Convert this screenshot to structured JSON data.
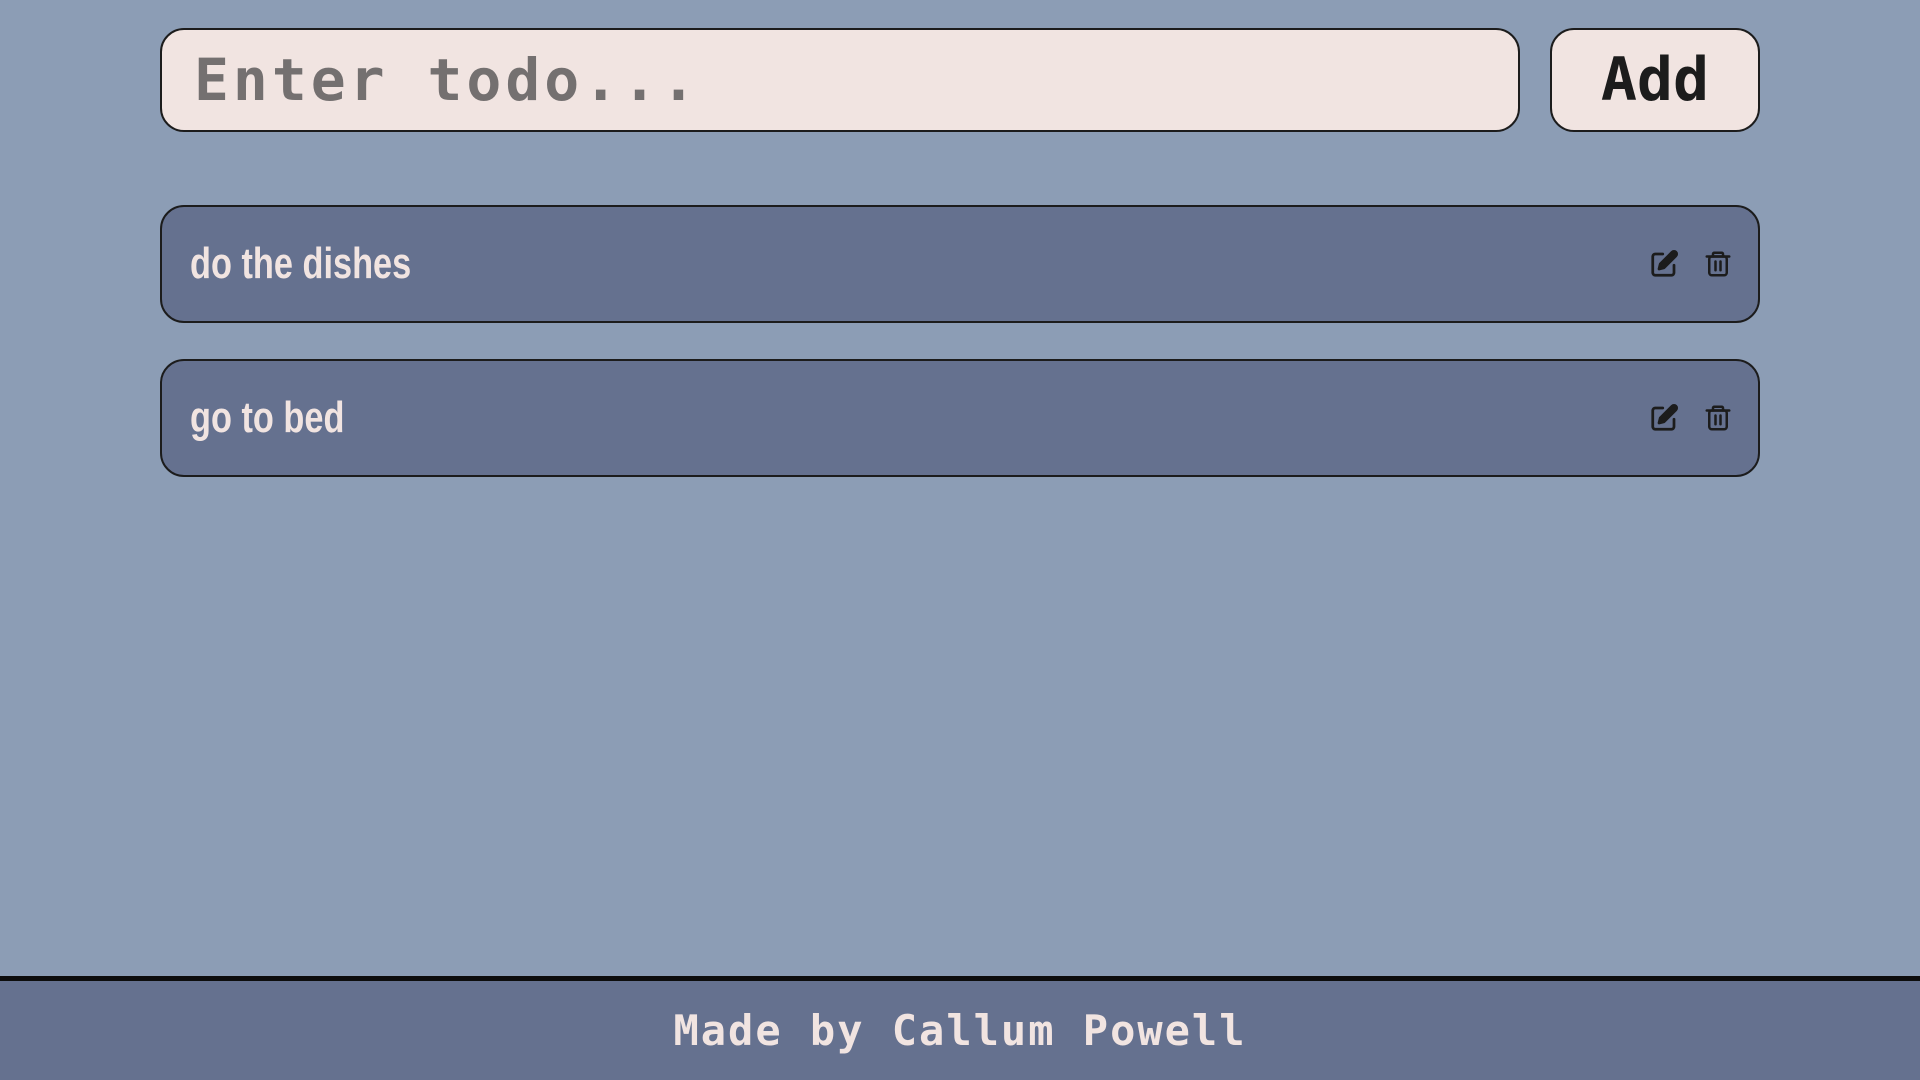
{
  "input": {
    "placeholder": "Enter todo...",
    "value": ""
  },
  "add_button": {
    "label": "Add"
  },
  "todos": [
    {
      "text": "do the dishes",
      "edit_icon": "edit-icon",
      "delete_icon": "trash-icon"
    },
    {
      "text": "go to bed",
      "edit_icon": "edit-icon",
      "delete_icon": "trash-icon"
    }
  ],
  "footer": {
    "text": "Made by Callum Powell"
  },
  "colors": {
    "background": "#8c9db5",
    "input_background": "#f1e4e1",
    "item_background": "#65718f",
    "text_light": "#f1e4e1",
    "border": "#1c1c1c"
  }
}
